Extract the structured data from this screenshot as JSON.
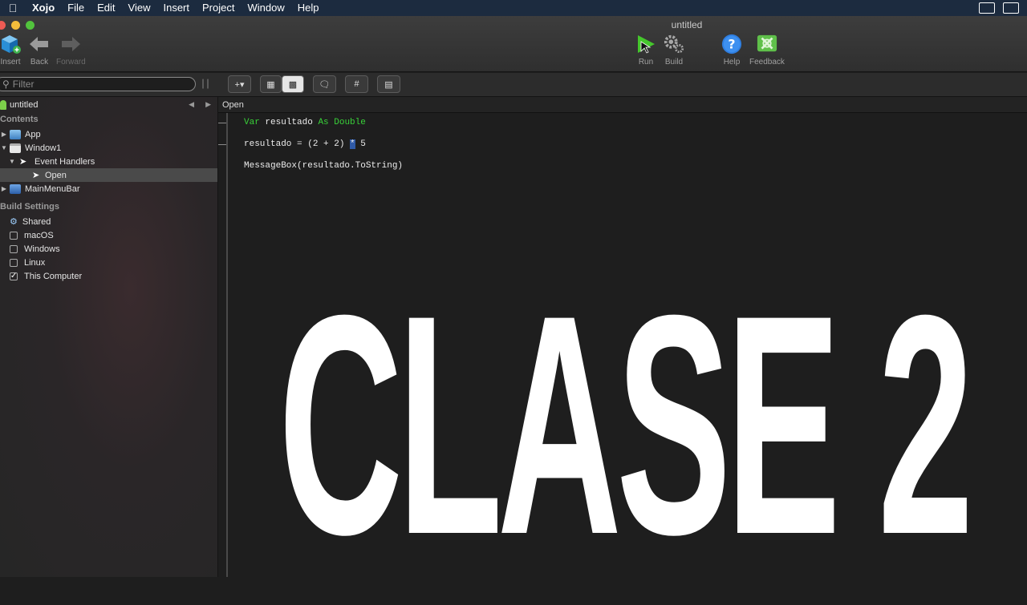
{
  "menubar": {
    "app_name": "Xojo",
    "items": [
      "File",
      "Edit",
      "View",
      "Insert",
      "Project",
      "Window",
      "Help"
    ]
  },
  "window": {
    "title": "untitled"
  },
  "toolbar": {
    "insert_label": "Insert",
    "back_label": "Back",
    "forward_label": "Forward",
    "run_label": "Run",
    "build_label": "Build",
    "help_label": "Help",
    "feedback_label": "Feedback"
  },
  "filter": {
    "placeholder": "Filter"
  },
  "navigator": {
    "project_name": "untitled",
    "contents_header": "Contents",
    "items": [
      {
        "label": "App"
      },
      {
        "label": "Window1"
      },
      {
        "label": "Event Handlers"
      },
      {
        "label": "Open"
      },
      {
        "label": "MainMenuBar"
      }
    ],
    "build_header": "Build Settings",
    "build_items": [
      {
        "label": "Shared",
        "checked": false
      },
      {
        "label": "macOS",
        "checked": false
      },
      {
        "label": "Windows",
        "checked": false
      },
      {
        "label": "Linux",
        "checked": false
      },
      {
        "label": "This Computer",
        "checked": true
      }
    ]
  },
  "editor": {
    "method_name": "Open",
    "line1": {
      "kw1": "Var",
      "name": " resultado ",
      "kw2": "As Double"
    },
    "line2": {
      "pre": "resultado = (2 + 2) ",
      "op": "*",
      "post": " 5"
    },
    "line3": "MessageBox(resultado.ToString)"
  },
  "overlay": {
    "text": "CLASE 2"
  },
  "colors": {
    "keyword": "#39d239",
    "selection": "#2f5aa8",
    "menubar": "#1c2b3f"
  }
}
